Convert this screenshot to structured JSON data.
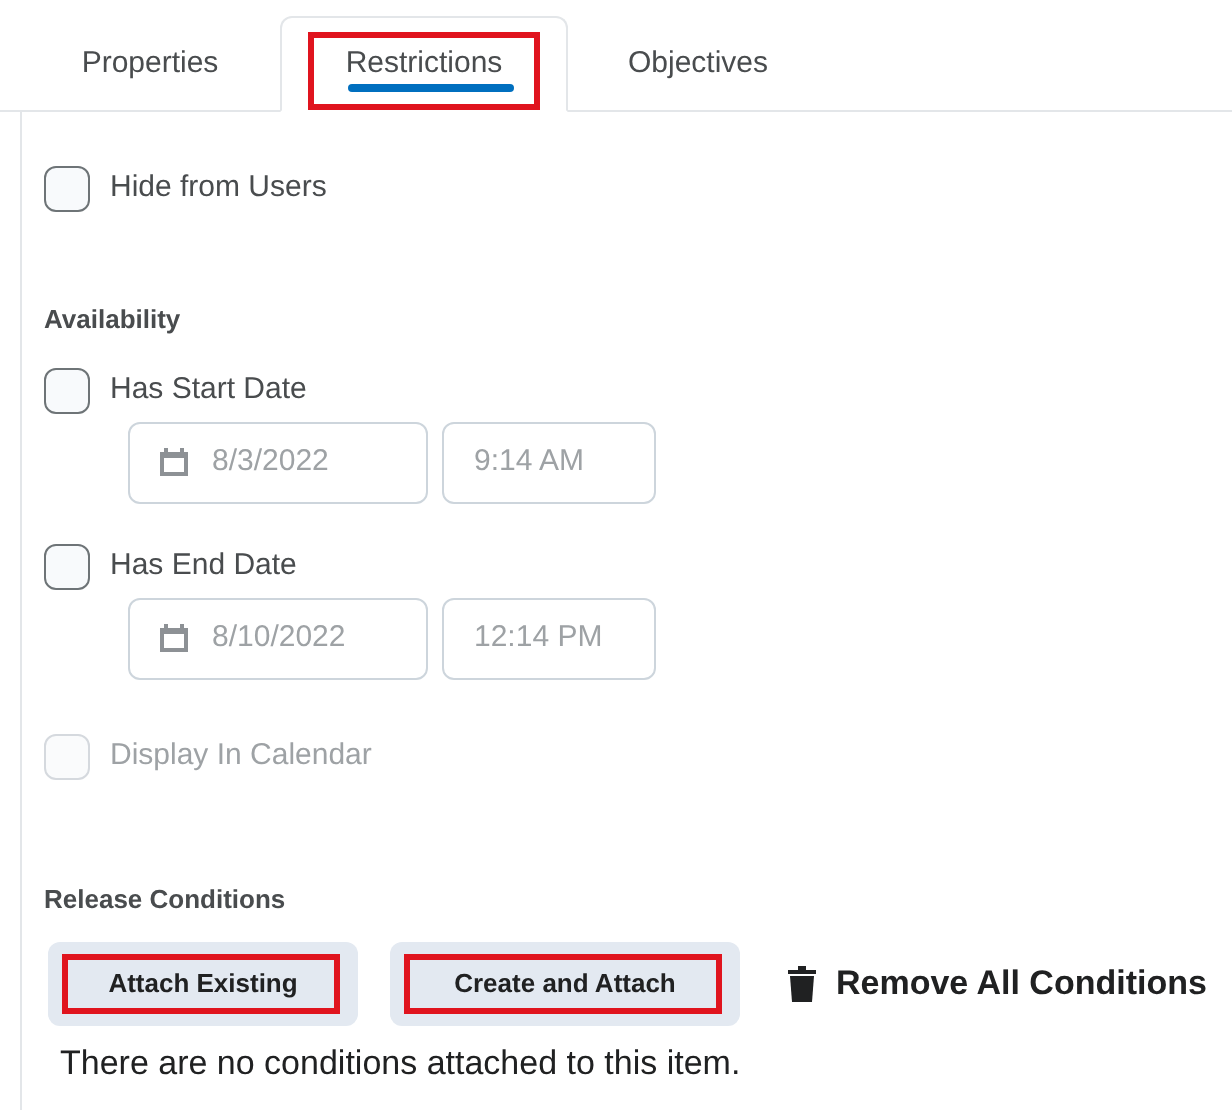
{
  "tabs": [
    {
      "label": "Properties",
      "selected": false,
      "highlighted": false
    },
    {
      "label": "Restrictions",
      "selected": true,
      "highlighted": true
    },
    {
      "label": "Objectives",
      "selected": false,
      "highlighted": false
    }
  ],
  "hide_from_users": {
    "label": "Hide from Users",
    "checked": false,
    "disabled": false
  },
  "availability": {
    "heading": "Availability",
    "items": [
      {
        "label": "Has Start Date",
        "checked": false,
        "disabled": false,
        "date": "8/3/2022",
        "time": "9:14 AM",
        "fields_disabled": true
      },
      {
        "label": "Has End Date",
        "checked": false,
        "disabled": false,
        "date": "8/10/2022",
        "time": "12:14 PM",
        "fields_disabled": true
      }
    ],
    "display_in_calendar": {
      "label": "Display In Calendar",
      "checked": false,
      "disabled": true
    }
  },
  "release_conditions": {
    "heading": "Release Conditions",
    "buttons": [
      {
        "label": "Attach Existing",
        "highlighted": true
      },
      {
        "label": "Create and Attach",
        "highlighted": true
      }
    ],
    "remove_all": "Remove All Conditions",
    "message": "There are no conditions attached to this item."
  }
}
